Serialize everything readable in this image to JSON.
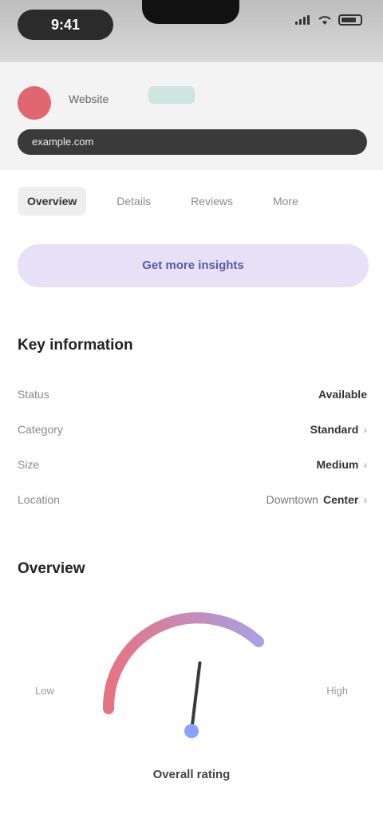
{
  "status_bar": {
    "time": "9:41",
    "icons": [
      "signal-icon",
      "wifi-icon",
      "battery-icon"
    ]
  },
  "header": {
    "site_title": "Website",
    "url": "example.com"
  },
  "tabs": [
    {
      "label": "Overview",
      "active": true
    },
    {
      "label": "Details",
      "active": false
    },
    {
      "label": "Reviews",
      "active": false
    },
    {
      "label": "More",
      "active": false
    }
  ],
  "promo": {
    "label": "Get more insights"
  },
  "info": {
    "title": "Key information",
    "rows": [
      {
        "label": "Status",
        "value": "Available",
        "sub": "",
        "chevron": false
      },
      {
        "label": "Category",
        "value": "Standard",
        "sub": "",
        "chevron": true
      },
      {
        "label": "Size",
        "value": "Medium",
        "sub": "",
        "chevron": true
      },
      {
        "label": "Location",
        "value": "Center",
        "sub": "Downtown",
        "chevron": true
      }
    ]
  },
  "score": {
    "title": "Overview",
    "left_label": "Low",
    "right_label": "High",
    "footer": "Overall rating",
    "value_fraction": 0.55,
    "colors": {
      "low": "#e15a6a",
      "high": "#9b8fe0",
      "needle": "#3a3a3a",
      "center": "#8aa2ff"
    }
  }
}
